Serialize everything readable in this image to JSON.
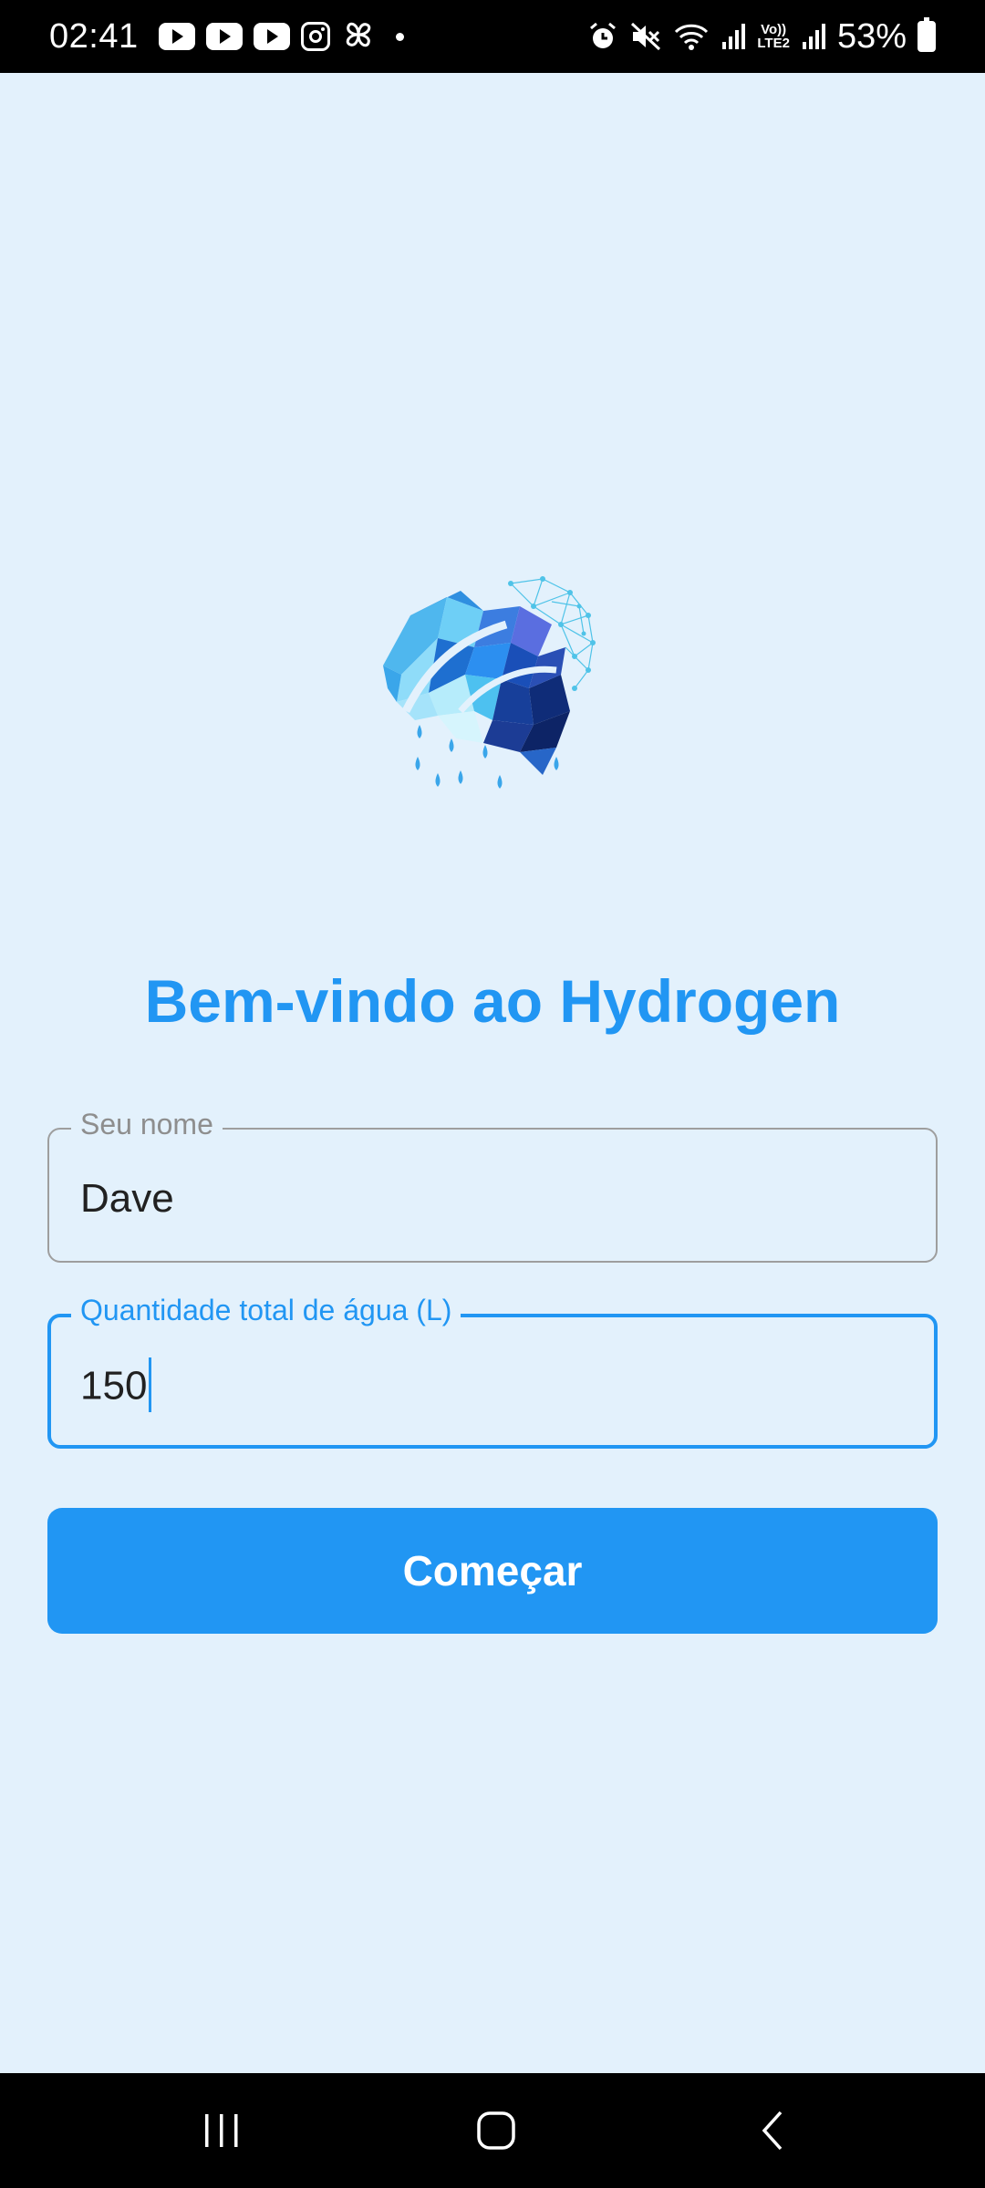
{
  "status_bar": {
    "time": "02:41",
    "battery": "53%",
    "network_label_top": "Vo))",
    "network_label_bottom": "LTE2",
    "notification_icons": [
      "youtube-icon",
      "youtube-icon",
      "youtube-icon",
      "instagram-icon",
      "pinwheel-icon",
      "more-dot-icon"
    ],
    "system_icons": [
      "alarm-icon",
      "mute-icon",
      "wifi-icon",
      "signal-icon",
      "signal-icon",
      "battery-charging-icon"
    ]
  },
  "main": {
    "title": "Bem-vindo ao Hydrogen",
    "name_field": {
      "label": "Seu nome",
      "value": "Dave"
    },
    "water_field": {
      "label": "Quantidade total de água (L)",
      "value": "150"
    },
    "start_button": "Começar"
  },
  "colors": {
    "background": "#e3f1fc",
    "accent": "#2196f3",
    "inactive_border": "#9e9e9e"
  },
  "nav_bar": {
    "icons": [
      "recents-icon",
      "home-icon",
      "back-icon"
    ]
  }
}
